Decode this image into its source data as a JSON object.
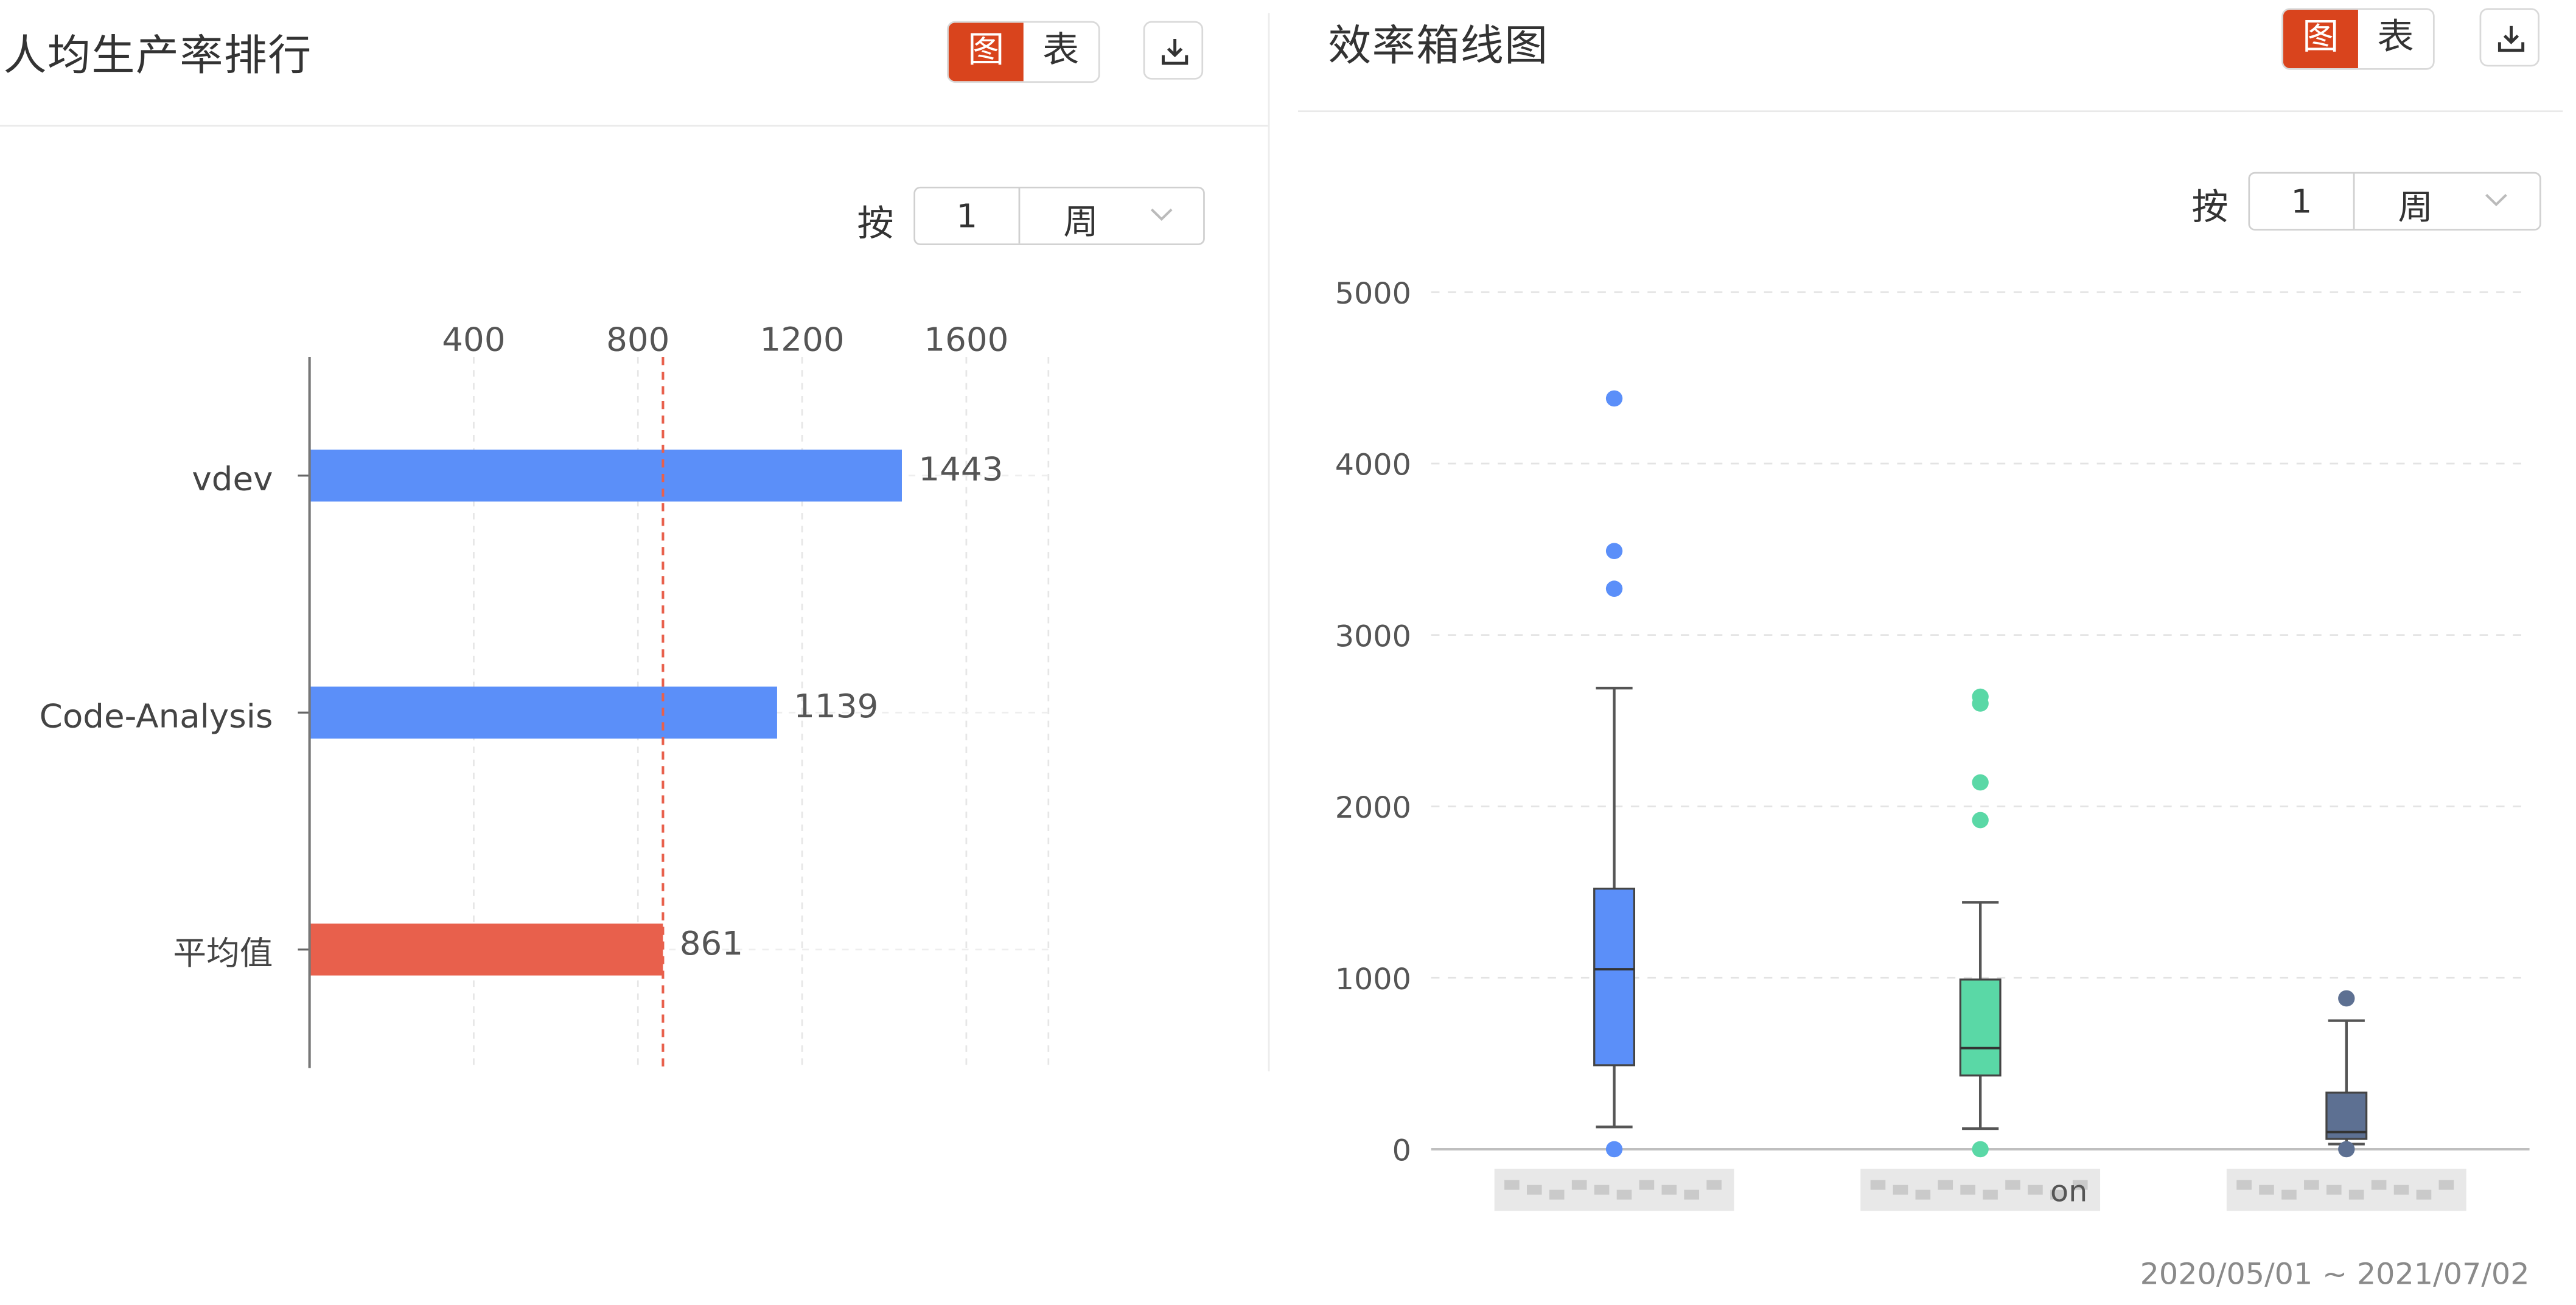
{
  "left_panel": {
    "title": "人均生产率排行",
    "toggle": {
      "chart_label": "图",
      "table_label": "表"
    },
    "by_label": "按",
    "period_value": "1",
    "period_unit": "周"
  },
  "right_panel": {
    "title": "效率箱线图",
    "toggle": {
      "chart_label": "图",
      "table_label": "表"
    },
    "by_label": "按",
    "period_value": "1",
    "period_unit": "周",
    "date_range": "2020/05/01 ~ 2021/07/02"
  },
  "chart_data": [
    {
      "type": "bar",
      "orientation": "horizontal",
      "categories": [
        "vdev",
        "Code-Analysis",
        "平均值"
      ],
      "values": [
        1443,
        1139,
        861
      ],
      "bar_colors": [
        "#5b8ff9",
        "#5b8ff9",
        "#e8604c"
      ],
      "xticks": [
        400,
        800,
        1200,
        1600
      ],
      "xlim": [
        0,
        1800
      ],
      "reference_line": {
        "value": 861,
        "color": "#e8604c",
        "style": "dashed"
      },
      "axis_position": "top",
      "grid": true
    },
    {
      "type": "box",
      "categories": [
        "",
        "",
        ""
      ],
      "category_labels_note": "x-axis category labels are blurred/redacted in the original",
      "visible_label_fragment": "on",
      "yticks": [
        0,
        1000,
        2000,
        3000,
        4000,
        5000
      ],
      "ylim": [
        0,
        5000
      ],
      "grid": true,
      "boxes": [
        {
          "color": "#5b8ff9",
          "min": 130,
          "q1": 490,
          "median": 1050,
          "q3": 1520,
          "max": 2690,
          "outliers": [
            4380,
            3490,
            3270,
            0
          ]
        },
        {
          "color": "#5ad8a6",
          "min": 120,
          "q1": 430,
          "median": 590,
          "q3": 990,
          "max": 1440,
          "outliers": [
            2640,
            2600,
            2140,
            1920,
            0
          ]
        },
        {
          "color": "#5d7092",
          "min": 30,
          "q1": 60,
          "median": 100,
          "q3": 330,
          "max": 750,
          "outliers": [
            880,
            0
          ]
        }
      ]
    }
  ]
}
